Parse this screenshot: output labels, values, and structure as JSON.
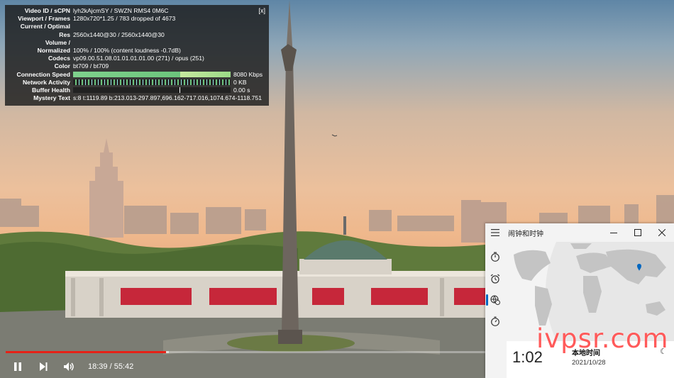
{
  "stats": {
    "close_label": "[x]",
    "rows": [
      {
        "key": "Video ID / sCPN",
        "value": "lyh2kAjcmSY / SWZN RMS4 0M6C"
      },
      {
        "key": "Viewport / Frames",
        "value": "1280x720*1.25 / 783 dropped of 4673"
      },
      {
        "key": "Current / Optimal",
        "value": ""
      },
      {
        "key": "Res",
        "value": "2560x1440@30 / 2560x1440@30"
      },
      {
        "key": "Volume /",
        "value": ""
      },
      {
        "key": "Normalized",
        "value": "100% / 100% (content loudness -0.7dB)"
      },
      {
        "key": "Codecs",
        "value": "vp09.00.51.08.01.01.01.01.00 (271) / opus (251)"
      },
      {
        "key": "Color",
        "value": "bt709 / bt709"
      }
    ],
    "connection_speed": {
      "key": "Connection Speed",
      "value": "8080 Kbps"
    },
    "network_activity": {
      "key": "Network Activity",
      "value": "0 KB"
    },
    "buffer_health": {
      "key": "Buffer Health",
      "value": "0.00 s"
    },
    "mystery": {
      "key": "Mystery Text",
      "value": "s:8 t:1119.89 b:213.013-297.897,696.162-717.016,1074.674-1118.751"
    }
  },
  "player": {
    "time_display": "18:39 / 55:42",
    "progress_fraction": 0.335,
    "buffered_start": 0.32,
    "buffered_end": 0.335,
    "accent": "#e62117"
  },
  "clock_window": {
    "title": "闹钟和时钟",
    "nav_icons": [
      "timer-icon",
      "alarm-icon",
      "world-clock-icon",
      "stopwatch-icon"
    ],
    "local_time": "1:02",
    "local_label": "本地时间",
    "local_date": "2021/10/28",
    "accent": "#0067c0"
  },
  "watermark": "ivpsr.com"
}
